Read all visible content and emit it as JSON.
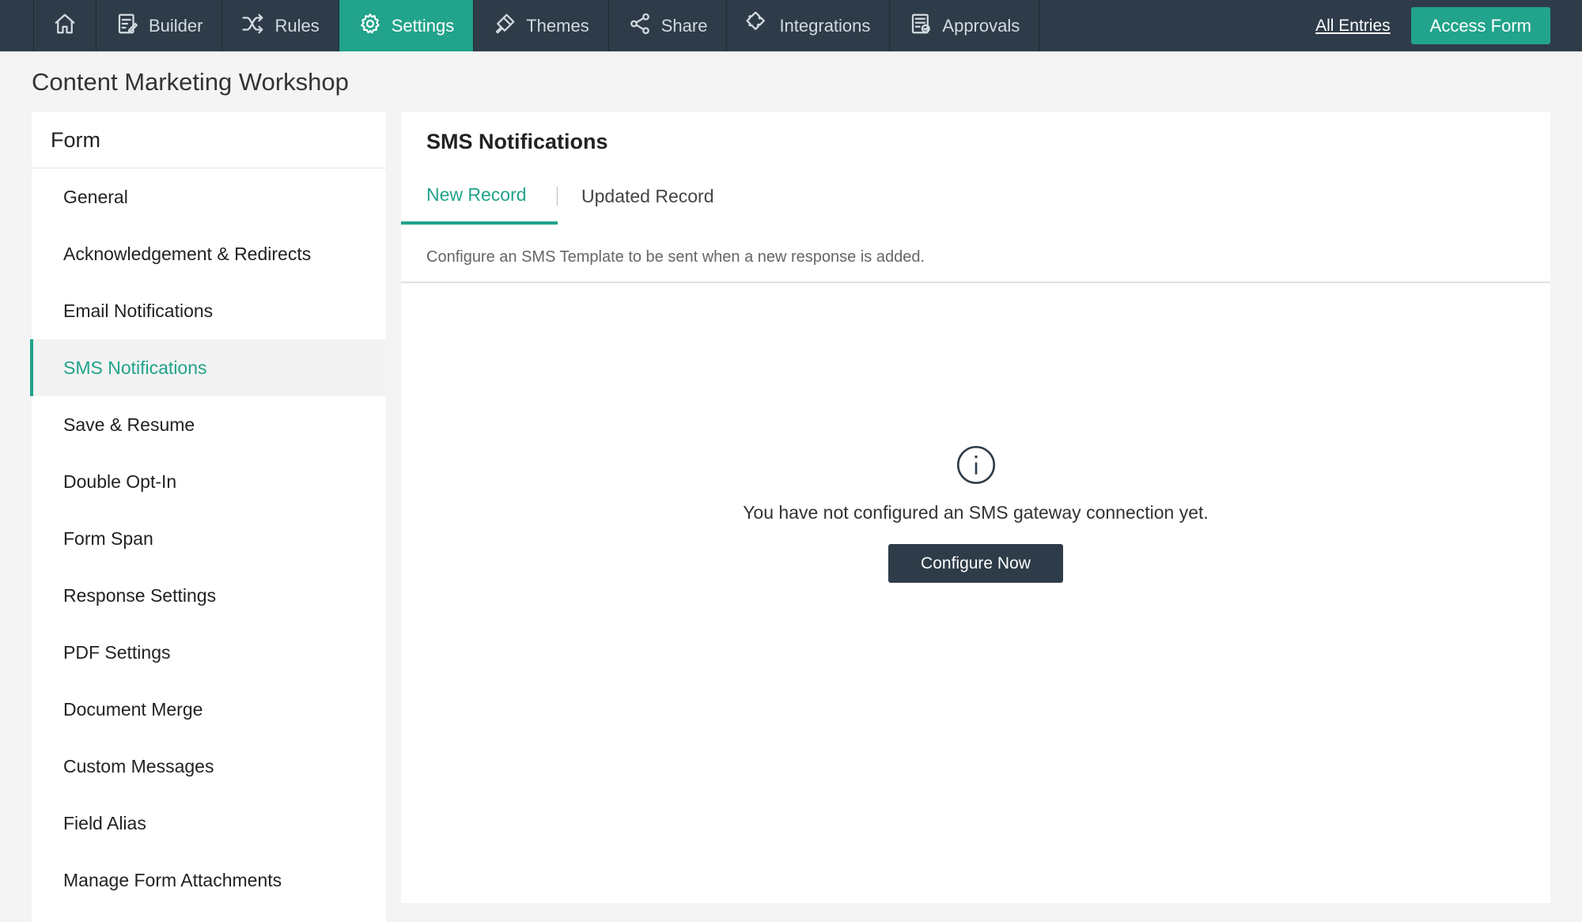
{
  "topnav": {
    "home_icon": "home-icon",
    "items": [
      {
        "label": "Builder",
        "icon": "builder-icon"
      },
      {
        "label": "Rules",
        "icon": "shuffle-icon"
      },
      {
        "label": "Settings",
        "icon": "gear-icon",
        "active": true
      },
      {
        "label": "Themes",
        "icon": "brush-icon"
      },
      {
        "label": "Share",
        "icon": "share-icon"
      },
      {
        "label": "Integrations",
        "icon": "puzzle-icon"
      },
      {
        "label": "Approvals",
        "icon": "approval-icon"
      }
    ],
    "all_entries": "All Entries",
    "access_form": "Access Form"
  },
  "page": {
    "title": "Content Marketing Workshop"
  },
  "sidebar": {
    "heading": "Form",
    "items": [
      {
        "label": "General"
      },
      {
        "label": "Acknowledgement & Redirects"
      },
      {
        "label": "Email Notifications"
      },
      {
        "label": "SMS Notifications",
        "active": true
      },
      {
        "label": "Save & Resume"
      },
      {
        "label": "Double Opt-In"
      },
      {
        "label": "Form Span"
      },
      {
        "label": "Response Settings"
      },
      {
        "label": "PDF Settings"
      },
      {
        "label": "Document Merge"
      },
      {
        "label": "Custom Messages"
      },
      {
        "label": "Field Alias"
      },
      {
        "label": "Manage Form Attachments"
      }
    ]
  },
  "panel": {
    "title": "SMS Notifications",
    "tabs": [
      {
        "label": "New Record",
        "active": true
      },
      {
        "label": "Updated Record"
      }
    ],
    "description": "Configure an SMS Template to be sent when a new response is added.",
    "empty_message": "You have not configured an SMS gateway connection yet.",
    "configure_button": "Configure Now"
  },
  "colors": {
    "topbar": "#2e3c49",
    "accent": "#22a38b",
    "background": "#f4f4f4"
  }
}
